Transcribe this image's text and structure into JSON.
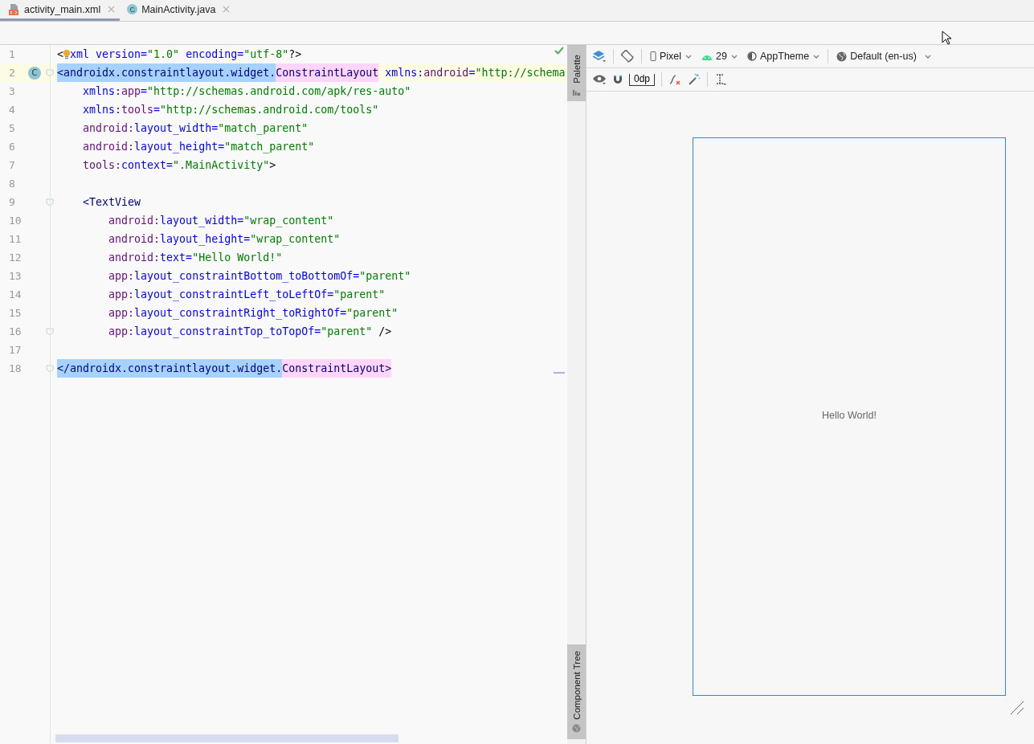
{
  "tabs": [
    {
      "label": "activity_main.xml",
      "kind": "xml",
      "selected": true
    },
    {
      "label": "MainActivity.java",
      "kind": "class",
      "badge": "C",
      "selected": false
    }
  ],
  "editor": {
    "lines": [
      {
        "number": "1",
        "tokens": [
          {
            "text": "<",
            "kind": "punct"
          },
          {
            "kind": "bulb"
          },
          {
            "text": "xml version=",
            "kind": "attr"
          },
          {
            "text": "\"1.0\"",
            "kind": "str"
          },
          {
            "text": " encoding=",
            "kind": "attr"
          },
          {
            "text": "\"utf-8\"",
            "kind": "str"
          },
          {
            "text": "?>",
            "kind": "punct"
          }
        ]
      },
      {
        "number": "2",
        "current": true,
        "badge": "C",
        "fold": true,
        "tokens": [
          {
            "text": "<androidx.constraintlayout.widget.",
            "kind": "tag",
            "selected": true
          },
          {
            "text": "ConstraintLayout",
            "kind": "tag",
            "matched": true
          },
          {
            "text": " xmlns:",
            "kind": "attr"
          },
          {
            "text": "android",
            "kind": "ns"
          },
          {
            "text": "=",
            "kind": "attr"
          },
          {
            "text": "\"http://schema",
            "kind": "str"
          }
        ]
      },
      {
        "number": "3",
        "tokens": [
          {
            "text": "    xmlns:",
            "kind": "attr"
          },
          {
            "text": "app",
            "kind": "ns"
          },
          {
            "text": "=",
            "kind": "attr"
          },
          {
            "text": "\"http://schemas.android.com/apk/res-auto\"",
            "kind": "str"
          }
        ]
      },
      {
        "number": "4",
        "tokens": [
          {
            "text": "    xmlns:",
            "kind": "attr"
          },
          {
            "text": "tools",
            "kind": "ns"
          },
          {
            "text": "=",
            "kind": "attr"
          },
          {
            "text": "\"http://schemas.android.com/tools\"",
            "kind": "str"
          }
        ]
      },
      {
        "number": "5",
        "tokens": [
          {
            "text": "    android:",
            "kind": "ns"
          },
          {
            "text": "layout_width=",
            "kind": "attr"
          },
          {
            "text": "\"match_parent\"",
            "kind": "str"
          }
        ]
      },
      {
        "number": "6",
        "tokens": [
          {
            "text": "    android:",
            "kind": "ns"
          },
          {
            "text": "layout_height=",
            "kind": "attr"
          },
          {
            "text": "\"match_parent\"",
            "kind": "str"
          }
        ]
      },
      {
        "number": "7",
        "tokens": [
          {
            "text": "    tools:",
            "kind": "ns"
          },
          {
            "text": "context=",
            "kind": "attr"
          },
          {
            "text": "\".MainActivity\"",
            "kind": "str"
          },
          {
            "text": ">",
            "kind": "punct"
          }
        ]
      },
      {
        "number": "8"
      },
      {
        "number": "9",
        "fold": true,
        "tokens": [
          {
            "text": "    <TextView",
            "kind": "tag"
          }
        ]
      },
      {
        "number": "10",
        "tokens": [
          {
            "text": "        android:",
            "kind": "ns"
          },
          {
            "text": "layout_width=",
            "kind": "attr"
          },
          {
            "text": "\"wrap_content\"",
            "kind": "str"
          }
        ]
      },
      {
        "number": "11",
        "tokens": [
          {
            "text": "        android:",
            "kind": "ns"
          },
          {
            "text": "layout_height=",
            "kind": "attr"
          },
          {
            "text": "\"wrap_content\"",
            "kind": "str"
          }
        ]
      },
      {
        "number": "12",
        "tokens": [
          {
            "text": "        android:",
            "kind": "ns"
          },
          {
            "text": "text=",
            "kind": "attr"
          },
          {
            "text": "\"Hello World!\"",
            "kind": "str"
          }
        ]
      },
      {
        "number": "13",
        "tokens": [
          {
            "text": "        app:",
            "kind": "ns"
          },
          {
            "text": "layout_constraintBottom_toBottomOf=",
            "kind": "attr"
          },
          {
            "text": "\"parent\"",
            "kind": "str"
          }
        ]
      },
      {
        "number": "14",
        "tokens": [
          {
            "text": "        app:",
            "kind": "ns"
          },
          {
            "text": "layout_constraintLeft_toLeftOf=",
            "kind": "attr"
          },
          {
            "text": "\"parent\"",
            "kind": "str"
          }
        ]
      },
      {
        "number": "15",
        "tokens": [
          {
            "text": "        app:",
            "kind": "ns"
          },
          {
            "text": "layout_constraintRight_toRightOf=",
            "kind": "attr"
          },
          {
            "text": "\"parent\"",
            "kind": "str"
          }
        ]
      },
      {
        "number": "16",
        "fold": true,
        "tokens": [
          {
            "text": "        app:",
            "kind": "ns"
          },
          {
            "text": "layout_constraintTop_toTopOf=",
            "kind": "attr"
          },
          {
            "text": "\"parent\"",
            "kind": "str"
          },
          {
            "text": " />",
            "kind": "punct"
          }
        ]
      },
      {
        "number": "17"
      },
      {
        "number": "18",
        "fold": true,
        "tokens": [
          {
            "text": "</androidx.constraintlayout.widget.",
            "kind": "tag",
            "selected": true
          },
          {
            "text": "ConstraintLayout>",
            "kind": "tag",
            "matched": true
          }
        ]
      }
    ]
  },
  "side_tabs": [
    "Palette",
    "Component Tree"
  ],
  "design_toolbar": {
    "device": "Pixel",
    "api": "29",
    "theme": "AppTheme",
    "locale": "Default (en-us)",
    "margin": "0dp"
  },
  "preview": {
    "text": "Hello World!"
  }
}
